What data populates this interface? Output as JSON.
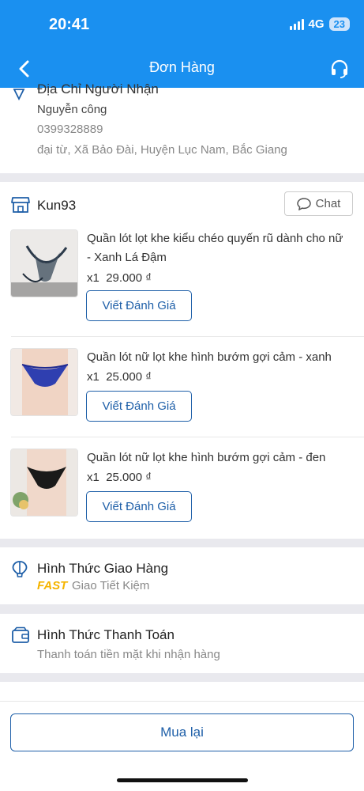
{
  "status_bar": {
    "time": "20:41",
    "network": "4G",
    "battery": "23"
  },
  "nav": {
    "title": "Đơn Hàng",
    "back_icon": "chevron-left-icon",
    "support_icon": "headset-icon"
  },
  "address": {
    "title": "Địa Chỉ Người Nhận",
    "name": "Nguyễn công",
    "phone": "0399328889",
    "line": "đại từ, Xã Bảo Đài, Huyện Lục Nam, Bắc Giang"
  },
  "shop": {
    "name": "Kun93",
    "chat_label": "Chat"
  },
  "items": [
    {
      "title": "Quần lót lọt khe kiểu chéo quyến rũ dành cho nữ - Xanh Lá Đậm",
      "quantity": "x1",
      "price": "29.000 ₫",
      "review_label": "Viết Đánh Giá"
    },
    {
      "title": "Quần lót nữ lọt khe hình bướm gợi cảm - xanh",
      "quantity": "x1",
      "price": "25.000 ₫",
      "review_label": "Viết Đánh Giá"
    },
    {
      "title": "Quần lót nữ lọt khe hình bướm gợi cảm - đen",
      "quantity": "x1",
      "price": "25.000 ₫",
      "review_label": "Viết Đánh Giá"
    }
  ],
  "shipping": {
    "title": "Hình Thức Giao Hàng",
    "badge": "FAST",
    "method": "Giao Tiết Kiệm"
  },
  "payment": {
    "title": "Hình Thức Thanh Toán",
    "method": "Thanh toán tiền mặt khi nhận hàng"
  },
  "actions": {
    "rebuy_label": "Mua lại"
  },
  "colors": {
    "primary": "#1a90f0",
    "button_border": "#1e5fa8",
    "fast": "#f5b400"
  }
}
